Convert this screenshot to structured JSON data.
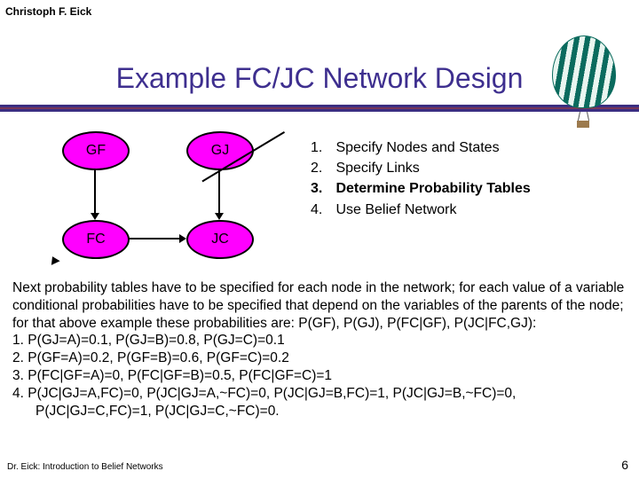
{
  "meta": {
    "author_top": "Christoph F. Eick",
    "footer_left": "Dr. Eick: Introduction to Belief Networks",
    "page_number": "6"
  },
  "title": "Example FC/JC Network Design",
  "nodes": {
    "gf": "GF",
    "gj": "GJ",
    "fc": "FC",
    "jc": "JC"
  },
  "edges": [
    {
      "from": "GF",
      "to": "FC"
    },
    {
      "from": "GJ",
      "to": "JC"
    },
    {
      "from": "GJ",
      "to": "FC"
    },
    {
      "from": "FC",
      "to": "JC"
    }
  ],
  "steps": [
    {
      "n": "1.",
      "text": "Specify Nodes and States",
      "bold": false
    },
    {
      "n": "2.",
      "text": "Specify Links",
      "bold": false
    },
    {
      "n": "3.",
      "text": "Determine Probability Tables",
      "bold": true
    },
    {
      "n": "4.",
      "text": "Use Belief Network",
      "bold": false
    }
  ],
  "paragraph": "Next probability tables have to be specified for each node in the network; for each value of a variable conditional probabilities have to be specified that depend on the variables of the parents of the node; for that above example these probabilities are: P(GF), P(GJ), P(FC|GF), P(JC|FC,GJ):",
  "prob_lines": [
    "1.   P(GJ=A)=0.1, P(GJ=B)=0.8, P(GJ=C)=0.1",
    "2.   P(GF=A)=0.2, P(GF=B)=0.6, P(GF=C)=0.2",
    "3.   P(FC|GF=A)=0, P(FC|GF=B)=0.5, P(FC|GF=C)=1",
    "4.   P(JC|GJ=A,FC)=0, P(JC|GJ=A,~FC)=0, P(JC|GJ=B,FC)=1, P(JC|GJ=B,~FC)=0, P(JC|GJ=C,FC)=1, P(JC|GJ=C,~FC)=0."
  ],
  "chart_data": {
    "type": "table",
    "title": "Probability tables for FC/JC belief network",
    "series": [
      {
        "name": "P(GJ)",
        "categories": [
          "A",
          "B",
          "C"
        ],
        "values": [
          0.1,
          0.8,
          0.1
        ]
      },
      {
        "name": "P(GF)",
        "categories": [
          "A",
          "B",
          "C"
        ],
        "values": [
          0.2,
          0.6,
          0.2
        ]
      },
      {
        "name": "P(FC|GF)",
        "categories": [
          "GF=A",
          "GF=B",
          "GF=C"
        ],
        "values": [
          0,
          0.5,
          1
        ]
      },
      {
        "name": "P(JC|GJ,FC)",
        "categories": [
          "GJ=A,FC",
          "GJ=A,~FC",
          "GJ=B,FC",
          "GJ=B,~FC",
          "GJ=C,FC",
          "GJ=C,~FC"
        ],
        "values": [
          0,
          0,
          1,
          0,
          1,
          0
        ]
      }
    ]
  }
}
